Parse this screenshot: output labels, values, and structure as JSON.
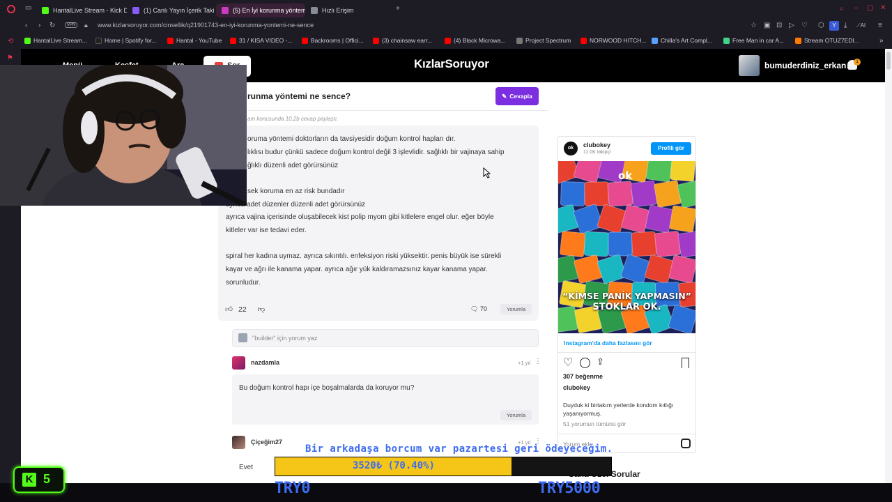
{
  "browser": {
    "tabs": [
      {
        "label": "HantalLive Stream - Kick D",
        "color": "#53fc18"
      },
      {
        "label": "(1) Canlı Yayın İçerik Takib",
        "color": "#8a5cf6"
      },
      {
        "label": "(5) En İyi korunma yöntem",
        "color": "#c93cbf"
      },
      {
        "label": "Hızlı Erişim",
        "color": "#8a8a96"
      }
    ],
    "vpn_label": "VPN",
    "url": "www.kizlarsoruyor.com/cinsellik/q21901743-en-iyi-korunma-yontemi-ne-sence",
    "bookmarks": [
      {
        "label": "HantalLive Stream...",
        "color": "#53fc18"
      },
      {
        "label": "Home | Spotify for...",
        "color": "#222222"
      },
      {
        "label": "Hantal - YouTube",
        "color": "#ff0000"
      },
      {
        "label": "31 / KISA VIDEO -...",
        "color": "#ff0000"
      },
      {
        "label": "Backrooms | Offici...",
        "color": "#ff0000"
      },
      {
        "label": "(3) chainsaw earr...",
        "color": "#ff0000"
      },
      {
        "label": "(4) Black Microwa...",
        "color": "#ff0000"
      },
      {
        "label": "Project Spectrum",
        "color": "#777777"
      },
      {
        "label": "NORWOOD HITCH...",
        "color": "#ff0000"
      },
      {
        "label": "Chilla's Art Compl...",
        "color": "#5aa0ff"
      },
      {
        "label": "Free Man in car A...",
        "color": "#3fd48a"
      },
      {
        "label": "Stream OTUZ7EDI...",
        "color": "#ff7a00"
      }
    ]
  },
  "site": {
    "nav": {
      "menu": "Menü",
      "explore": "Keşfet",
      "search": "Ara",
      "ask": "Sor"
    },
    "logo": "KızlarSoruyor",
    "username": "bumuderdiniz_erkan",
    "notification_count": "1"
  },
  "question": {
    "title": "runma yöntemi ne sence?",
    "answer_button": "Cevapla",
    "meta": "am konusunda 10,2b cevap paylaştı."
  },
  "answer": {
    "lines": [
      "oruma yöntemi doktorların da tavsiyesidir doğum kontrol hapları dır.",
      "lıklısı budur çünkü sadece doğum kontrol değil 3 işlevlidir. sağlıklı bir vajinaya sahip",
      "ğlıklı düzenli adet görürsünüz",
      "",
      "sek koruma en az risk bundadır",
      "ayrıca adet düzenler düzenli adet görürsünüz",
      "ayrıca vajina içerisinde oluşabilecek kist polip myom gibi kitlelere engel olur. eğer böyle",
      "kitleler var ise tedavi eder.",
      "",
      "spiral her kadına uymaz. ayrıca sıkıntılı. enfeksiyon riski yüksektir. penis büyük ise sürekli",
      "kayar ve ağrı ile kanama yapar. ayrıca ağır yük kaldıramazsınız kayar kanama yapar.",
      "sorunludur."
    ],
    "likes": "22",
    "comments": "70",
    "reply_label": "Yorumla"
  },
  "comment_input": {
    "placeholder": "\"builder\" için yorum yaz"
  },
  "comments": [
    {
      "name": "nazdamla",
      "time": "+1 yıl",
      "text": "Bu doğum kontrol hapı içe boşalmalarda da koruyor mu?",
      "reply": "Yorumla"
    },
    {
      "name": "Çiçeğim27",
      "time": "+1 yıl"
    }
  ],
  "instagram": {
    "avatar": "ok",
    "account": "clubokey",
    "followers": "11.0K takipçi",
    "profile_button": "Profili gör",
    "image_logo": "ok",
    "image_text1": "“KİMSE PANİK YAPMASIN”",
    "image_text2": "STOKLAR OK.",
    "more": "Instagram'da daha fazlasını gör",
    "likes": "307 beğenme",
    "user": "clubokey",
    "caption": "Duyduk ki birtakım yerlerde kondom kıtlığı yaşanıyormuş.",
    "all_comments": "51 yorumun tümünü gör",
    "comment_placeholder": "Yorum ekle..."
  },
  "sidebar_heading": "Sana Özel Sorular",
  "poll_option": "Evet",
  "stream_overlay": {
    "donation_message": "Bir arkadaşa borcum var pazartesi geri ödeyeceğim.",
    "goal_text": "3520₺ (70.40%)",
    "goal_fraction": 0.704,
    "goal_start": "TRY0",
    "goal_end": "TRY5000",
    "kick_count": "5"
  }
}
